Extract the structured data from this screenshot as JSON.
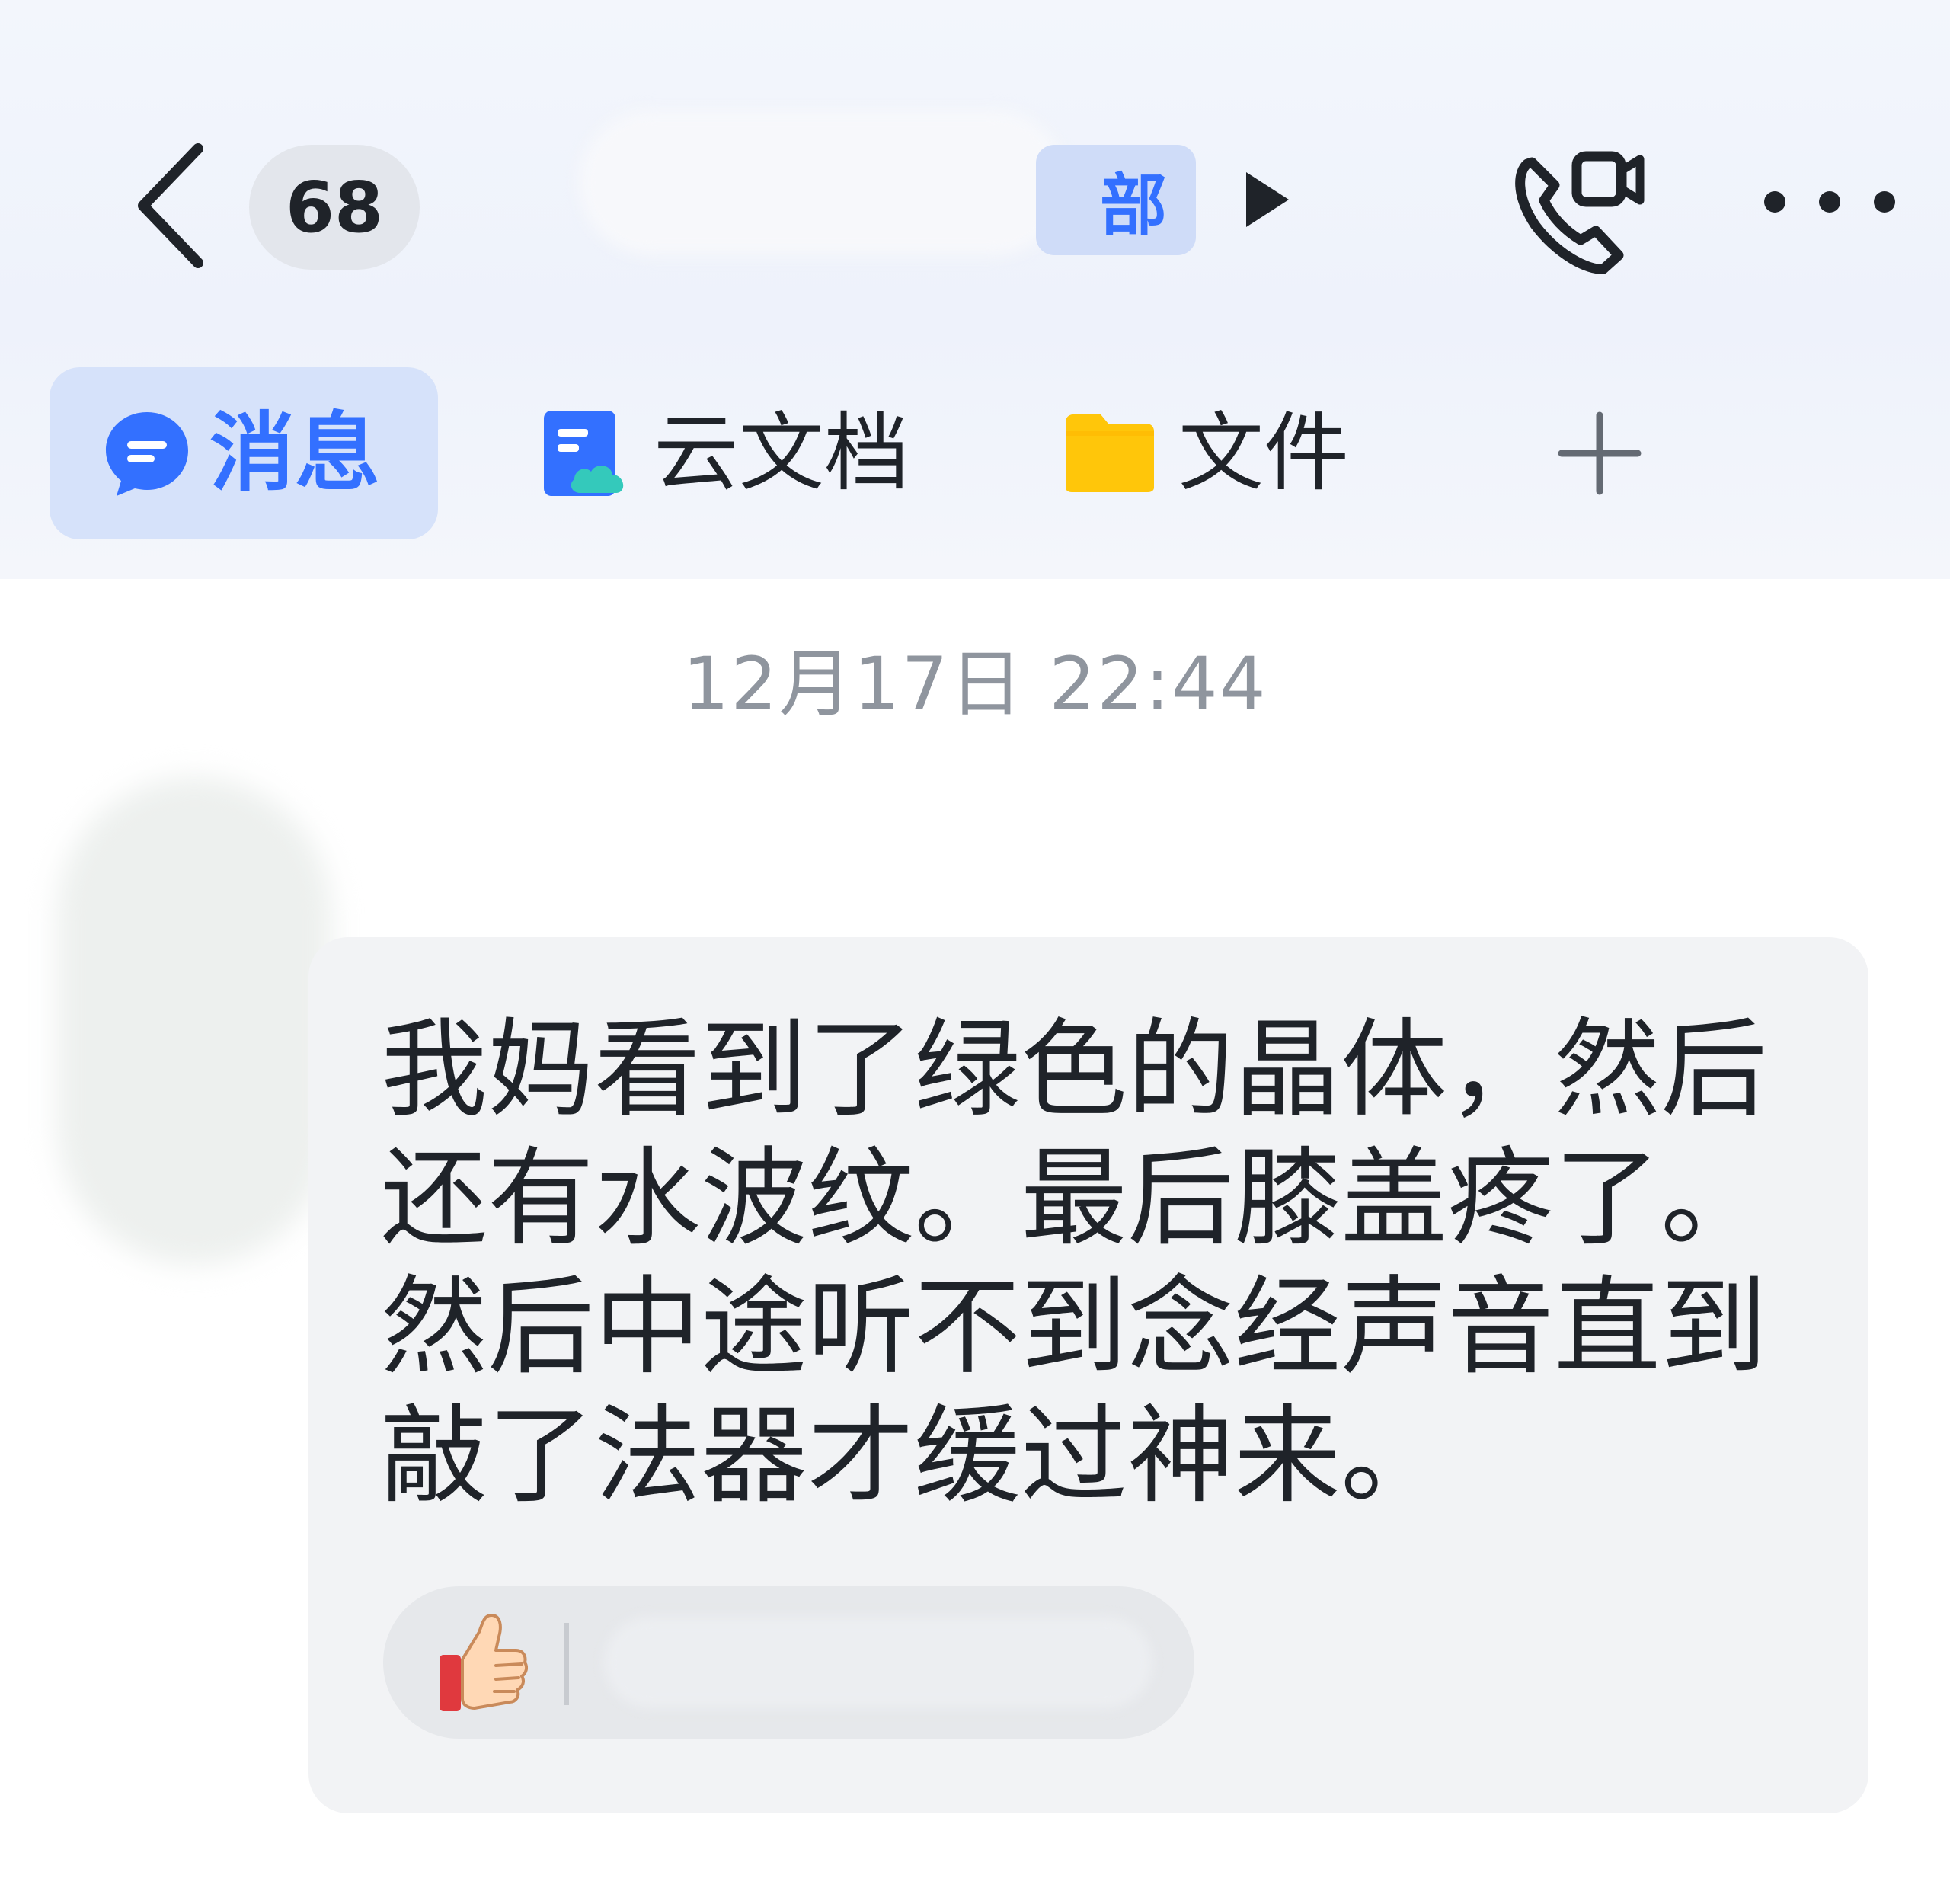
{
  "header": {
    "unread_count": "68",
    "chat_title_suffix": "部",
    "icons": {
      "back": "chevron-left-icon",
      "play": "triangle-right-icon",
      "call": "video-call-icon",
      "more": "more-dots-icon"
    }
  },
  "tabs": [
    {
      "label": "消息",
      "icon": "chat-bubble-icon",
      "active": true
    },
    {
      "label": "云文档",
      "icon": "cloud-doc-icon",
      "active": false
    },
    {
      "label": "文件",
      "icon": "folder-icon",
      "active": false
    }
  ],
  "add_tab_icon": "plus-icon",
  "message": {
    "timestamp": "12月17日 22:44",
    "text": "我妈看到了绿色的晶体，然后还有水波纹。最后膝盖疼了。然后中途听不到念经声音直到敲了法器才缓过神来。",
    "reaction_icon": "thumbs-up-icon"
  },
  "colors": {
    "accent": "#3370ff",
    "active_tab_bg": "#d6e2fa",
    "bubble_bg": "#f2f3f5",
    "timestamp": "#8f959e"
  }
}
